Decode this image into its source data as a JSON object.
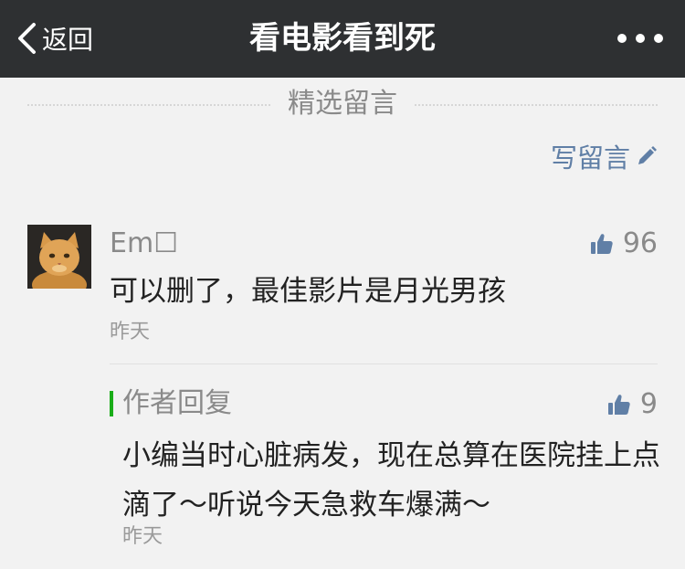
{
  "nav": {
    "back_label": "返回",
    "title": "看电影看到死"
  },
  "section": {
    "title": "精选留言",
    "write_label": "写留言"
  },
  "comment": {
    "author": "Em☐",
    "likes": "96",
    "text": "可以删了，最佳影片是月光男孩",
    "time": "昨天"
  },
  "reply": {
    "label": "作者回复",
    "likes": "9",
    "text": "小编当时心脏病发，现在总算在医院挂上点滴了～听说今天急救车爆满～",
    "time": "昨天"
  },
  "colors": {
    "navbar": "#2e3032",
    "background": "#f2f2f2",
    "link": "#607fa6",
    "reply_accent": "#1aad19",
    "muted": "#8a8a8a"
  },
  "icons": [
    "chevron-left-icon",
    "more-dots-icon",
    "pencil-icon",
    "thumbs-up-icon"
  ]
}
